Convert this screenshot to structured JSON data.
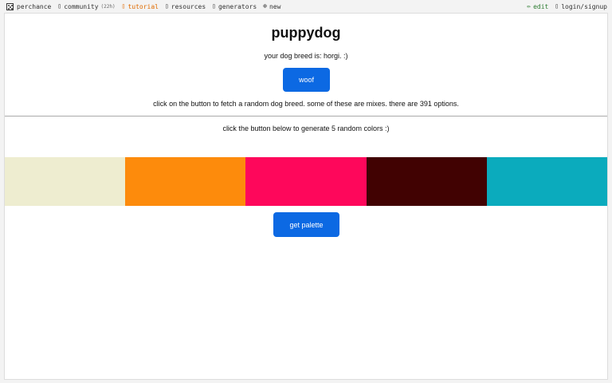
{
  "nav": {
    "brand": "perchance",
    "community": "community",
    "community_badge": "(22h)",
    "tutorial": "tutorial",
    "resources": "resources",
    "generators": "generators",
    "new": "new",
    "edit": "edit",
    "login": "login/signup"
  },
  "icons": {
    "brand": "dice-icon",
    "community": "chat-icon",
    "tutorial": "book-icon",
    "resources": "link-icon",
    "generators": "list-icon",
    "new": "plus-circle-icon",
    "edit": "pencil-icon",
    "login": "user-icon"
  },
  "main": {
    "title": "puppydog",
    "breed_line": "your dog breed is: horgi. :)",
    "woof_label": "woof",
    "info": "click on the button to fetch a random dog breed. some of these are mixes. there are 391 options.",
    "colors_info": "click the button below to generate 5 random colors :)",
    "palette_label": "get palette"
  },
  "palette": {
    "colors": [
      "#eeedd0",
      "#fd8b0c",
      "#fe075b",
      "#410202",
      "#0babbd"
    ]
  },
  "colors": {
    "button": "#0c69e3",
    "tutorial_link": "#e06b00",
    "edit_link": "#2e7d32"
  }
}
